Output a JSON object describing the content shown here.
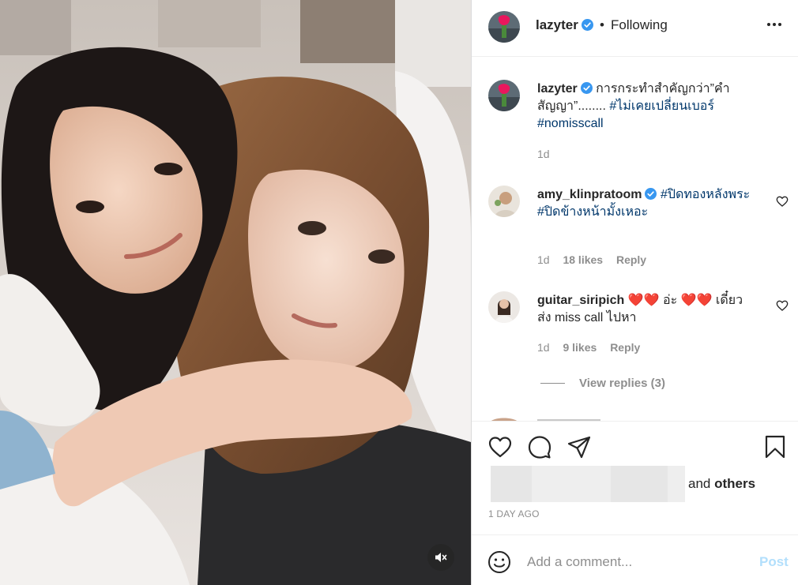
{
  "media": {
    "photo_icon": "photo-image",
    "mute_icon": "speaker-muted-icon"
  },
  "header": {
    "username": "lazyter",
    "dot": "•",
    "follow_status": "Following",
    "more_icon": "more-options-icon"
  },
  "caption": {
    "username": "lazyter",
    "text": "การกระทำสำคัญกว่า”คำสัญญา”........",
    "tags": [
      "#ไม่เคยเปลี่ยนเบอร์",
      "#nomisscall"
    ],
    "time": "1d"
  },
  "comments": [
    {
      "username": "amy_klinpratoom",
      "tags": [
        "#ปิดทองหลังพระ",
        "#ปิดข้างหน้ามั้งเหอะ"
      ],
      "time": "1d",
      "likes": "18 likes",
      "reply": "Reply"
    },
    {
      "username": "guitar_siripich",
      "text_part1": "❤️❤️ อ่ะ ❤️❤️ เดี๋ยว",
      "text_part2": "ส่ง miss call ไปหา",
      "time": "1d",
      "likes": "9 likes",
      "reply": "Reply",
      "view_replies": "View replies (3)"
    }
  ],
  "actions": {
    "and": "and",
    "others": "others",
    "timestamp": "1 DAY AGO"
  },
  "add_comment": {
    "placeholder": "Add a comment...",
    "post_label": "Post"
  },
  "colors": {
    "hashtag": "#00376b",
    "verified": "#3897f0",
    "post_disabled": "#b2dffc",
    "meta_gray": "#8e8e8e"
  }
}
